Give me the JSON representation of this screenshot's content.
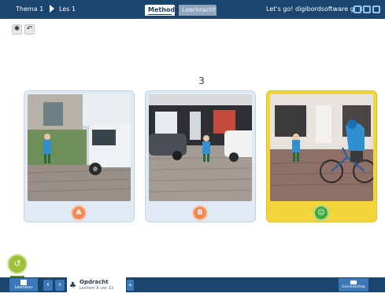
{
  "header": {
    "breadcrumb": [
      "Thema 1",
      "Les 1"
    ],
    "tabs": [
      {
        "label": "Methode",
        "active": true
      },
      {
        "label": "Leerkracht",
        "active": false
      }
    ],
    "app_title": "Let's go! digibordsoftware gr 4",
    "window_buttons": [
      "minimize-icon",
      "restore-icon",
      "help-icon",
      "close-icon"
    ]
  },
  "tools": [
    "gear-icon",
    "undo-icon"
  ],
  "question": {
    "number": "3"
  },
  "answers": [
    {
      "label": "A",
      "state": "normal"
    },
    {
      "label": "B",
      "state": "normal"
    },
    {
      "label": "☺",
      "state": "correct"
    }
  ],
  "footer": {
    "home_label": "Lesmenu",
    "assignment_title": "Opdracht",
    "assignment_subtitle": "Lesitem 8 van 13",
    "aside_label": "Gereedschap"
  },
  "colors": {
    "bar": "#19456e",
    "accent": "#3a78b8",
    "selected_card": "#f2d53a",
    "badge": "#f08a55",
    "correct": "#3fa93c"
  }
}
